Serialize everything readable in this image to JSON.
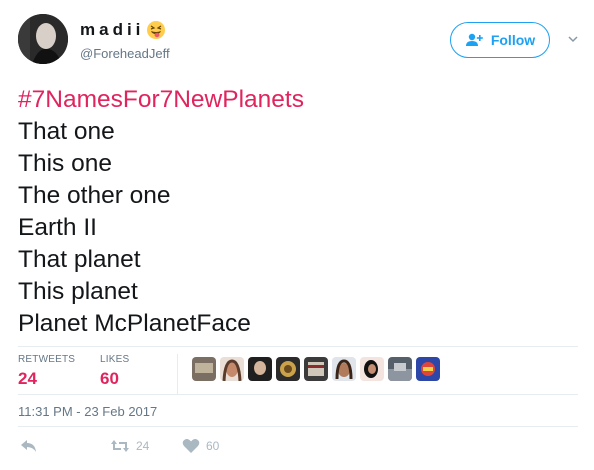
{
  "user": {
    "display_name": "madii",
    "handle": "@ForeheadJeff",
    "emoji_icon": "squinting-face-with-tongue-emoji"
  },
  "follow_button": {
    "label": "Follow"
  },
  "tweet": {
    "hashtag": "#7NamesFor7NewPlanets",
    "lines": [
      "That one",
      "This one",
      "The other one",
      "Earth II",
      "That planet",
      "This planet",
      "Planet McPlanetFace"
    ]
  },
  "stats": {
    "retweets_label": "RETWEETS",
    "retweets_value": "24",
    "likes_label": "LIKES",
    "likes_value": "60"
  },
  "timestamp": "11:31 PM - 23 Feb 2017",
  "actions": {
    "reply_icon": "reply-icon",
    "retweet_count": "24",
    "like_count": "60"
  },
  "colors": {
    "accent": "#1da1f2",
    "like": "#e0245e",
    "muted": "#657786",
    "icon": "#aab8c2"
  }
}
